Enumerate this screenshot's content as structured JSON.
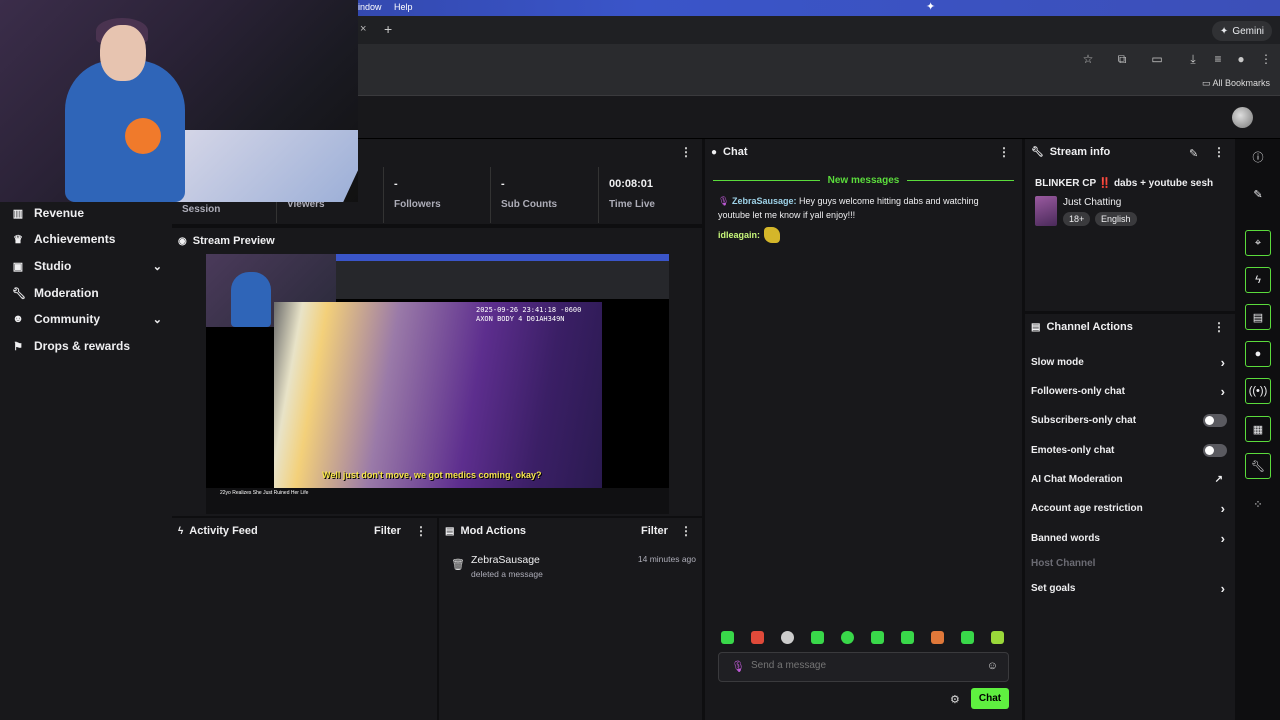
{
  "menubar": {
    "window": "indow",
    "help": "Help"
  },
  "browser": {
    "tab_close": "×",
    "new_tab": "+",
    "gemini": "Gemini",
    "all_bookmarks": "All Bookmarks"
  },
  "sidebar": {
    "items": [
      {
        "label": "Revenue",
        "icon": "bar-chart-icon"
      },
      {
        "label": "Achievements",
        "icon": "trophy-icon"
      },
      {
        "label": "Studio",
        "icon": "studio-icon",
        "expandable": true
      },
      {
        "label": "Moderation",
        "icon": "wrench-icon"
      },
      {
        "label": "Community",
        "icon": "users-icon",
        "expandable": true
      },
      {
        "label": "Drops & rewards",
        "icon": "gift-icon"
      }
    ]
  },
  "stats": {
    "session_label": "Session",
    "items": [
      {
        "value": "-",
        "label": "Viewers"
      },
      {
        "value": "-",
        "label": "Followers"
      },
      {
        "value": "-",
        "label": "Sub Counts"
      },
      {
        "value": "00:08:01",
        "label": "Time Live"
      }
    ]
  },
  "preview": {
    "title": "Stream Preview",
    "caption": "Well just don't move, we got medics coming, okay?",
    "stamp": "2025-09-26 23:41:18 -0600\nAXON BODY 4 D01AH349N",
    "video_title": "22yo Realizes She Just Ruined Her Life"
  },
  "activity": {
    "title": "Activity Feed",
    "filter": "Filter"
  },
  "mod_actions": {
    "title": "Mod Actions",
    "filter": "Filter",
    "rows": [
      {
        "user": "ZebraSausage",
        "action": "deleted a message",
        "time": "14 minutes ago"
      }
    ]
  },
  "chat": {
    "title": "Chat",
    "new_messages": "New messages",
    "messages": [
      {
        "user": "ZebraSausage:",
        "text": " Hey guys welcome hitting dabs and watching youtube let me know if yall enjoy!!!"
      },
      {
        "user": "idleagain:",
        "text": ""
      }
    ],
    "placeholder": "Send a message",
    "send_label": "Chat"
  },
  "stream_info": {
    "title": "Stream info",
    "stream_title_a": "BLINKER CP ",
    "stream_title_bang": "‼️",
    "stream_title_b": " dabs + youtube sesh",
    "category": "Just Chatting",
    "tags": [
      "18+",
      "English"
    ]
  },
  "channel_actions": {
    "title": "Channel Actions",
    "items": [
      {
        "label": "Slow mode",
        "control": "arrow"
      },
      {
        "label": "Followers-only chat",
        "control": "arrow"
      },
      {
        "label": "Subscribers-only chat",
        "control": "toggle"
      },
      {
        "label": "Emotes-only chat",
        "control": "toggle"
      },
      {
        "label": "AI Chat Moderation",
        "control": "external"
      },
      {
        "label": "Account age restriction",
        "control": "arrow"
      },
      {
        "label": "Banned words",
        "control": "arrow"
      },
      {
        "label": "Host Channel",
        "control": "none"
      },
      {
        "label": "Set goals",
        "control": "arrow"
      }
    ]
  },
  "colors": {
    "accent": "#5bdc3c",
    "chat_button": "#5ff040",
    "panel": "#18181b"
  }
}
